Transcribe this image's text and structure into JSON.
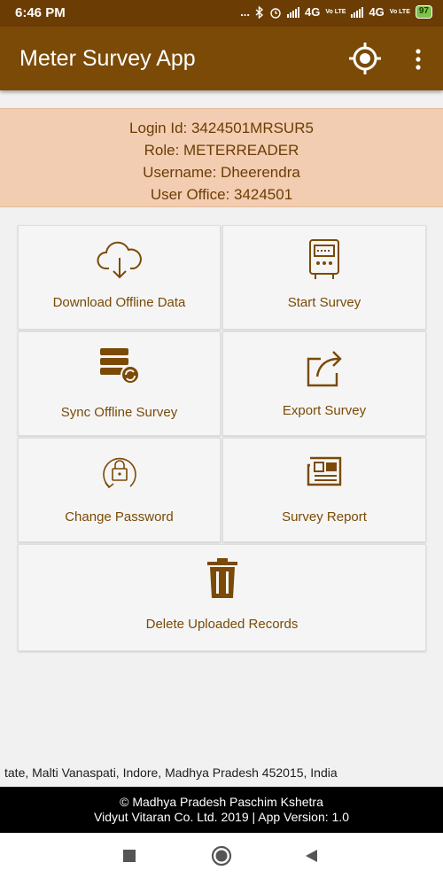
{
  "status_bar": {
    "time": "6:46 PM",
    "dots": "...",
    "net1": "4G",
    "net2": "4G",
    "volte": "Vo LTE",
    "battery": "97"
  },
  "app_bar": {
    "title": "Meter Survey App",
    "locate_icon": "crosshair-locate-icon",
    "menu_icon": "more-vert-icon"
  },
  "login_info": {
    "login_id": "Login Id: 3424501MRSUR5",
    "role": "Role: METERREADER",
    "username": "Username: Dheerendra",
    "user_office": "User Office: 3424501"
  },
  "menu": {
    "download": {
      "label": "Download Offline Data",
      "icon": "cloud-download-icon"
    },
    "start": {
      "label": "Start Survey",
      "icon": "electric-meter-icon"
    },
    "sync": {
      "label": "Sync Offline Survey",
      "icon": "server-sync-icon"
    },
    "export": {
      "label": "Export Survey",
      "icon": "share-export-icon"
    },
    "password": {
      "label": "Change Password",
      "icon": "lock-reset-icon"
    },
    "report": {
      "label": "Survey Report",
      "icon": "newspaper-report-icon"
    },
    "delete": {
      "label": "Delete Uploaded Records",
      "icon": "trash-icon"
    }
  },
  "address": "tate, Malti Vanaspati, Indore, Madhya Pradesh 452015, India",
  "footer": {
    "line1": "© Madhya Pradesh Paschim Kshetra",
    "line2": "Vidyut Vitaran Co. Ltd. 2019 | App Version: 1.0"
  },
  "colors": {
    "primary": "#7a4a06",
    "status": "#6b3d05",
    "card": "#f3cdb1",
    "accent_text": "#7a4a06"
  }
}
